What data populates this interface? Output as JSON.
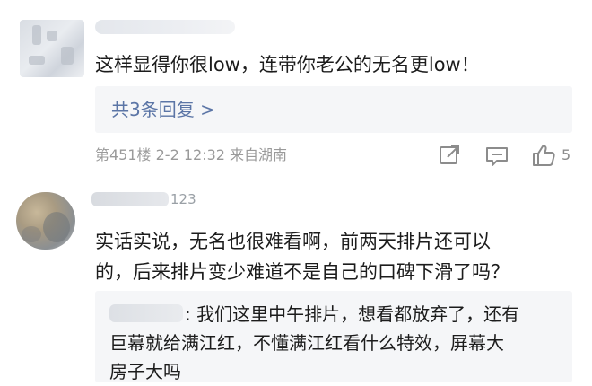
{
  "comments": [
    {
      "text": "这样显得你很low，连带你老公的无名更low！",
      "reply_summary": "共3条回复 >",
      "meta": "第451楼 2-2 12:32 来自湖南",
      "likes": "5"
    },
    {
      "name_suffix": "123",
      "text_lines": [
        "实话实说，无名也很难看啊，前两天排片还可以",
        "的，后来排片变少难道不是自己的口碑下滑了吗？"
      ],
      "reply": {
        "lines": [
          ": 我们这里中午排片，想看都放弃了，还有",
          "巨幕就给满江红，不懂满江红看什么特效，屏幕大",
          "房子大吗"
        ]
      }
    }
  ],
  "icons": {
    "share": "share-icon",
    "comment": "comment-icon",
    "like": "thumbs-up-icon"
  },
  "colors": {
    "link": "#5b75a6",
    "meta": "#9a9a9a",
    "reply_bg": "#f5f6f8"
  }
}
